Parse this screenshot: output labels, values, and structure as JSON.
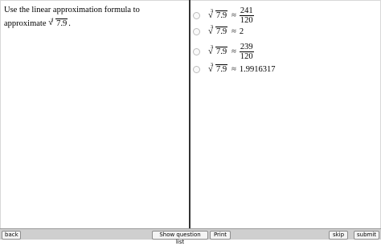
{
  "question": {
    "text_line1": "Use the linear approximation formula to",
    "text_line2_prefix": "approximate",
    "root_index": "3",
    "root_radicand": "7.9",
    "text_line2_suffix": "."
  },
  "choices": [
    {
      "root_index": "3",
      "radicand": "7.9",
      "approx": "≈",
      "numerator": "241",
      "denominator": "120"
    },
    {
      "root_index": "3",
      "radicand": "7.9",
      "approx": "≈",
      "value": "2"
    },
    {
      "root_index": "3",
      "radicand": "7.9",
      "approx": "≈",
      "numerator": "239",
      "denominator": "120"
    },
    {
      "root_index": "3",
      "radicand": "7.9",
      "approx": "≈",
      "value": "1.9916317"
    }
  ],
  "toolbar": {
    "back_label": "back",
    "show_question_list_label": "Show question list",
    "print_label": "Print",
    "skip_label": "skip",
    "submit_label": "submit"
  }
}
